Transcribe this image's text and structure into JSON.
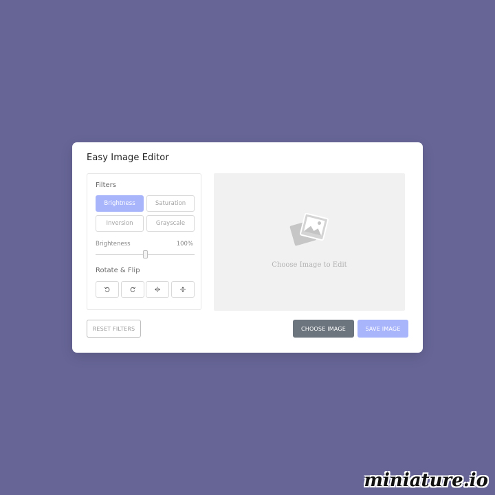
{
  "app": {
    "title": "Easy Image Editor"
  },
  "filters": {
    "label": "Filters",
    "options": [
      "Brightness",
      "Saturation",
      "Inversion",
      "Grayscale"
    ],
    "active": "Brightness"
  },
  "slider": {
    "name": "Brighteness",
    "value_text": "100%",
    "value_fraction": 0.5
  },
  "rotate": {
    "label": "Rotate & Flip",
    "icons": [
      "rotate-left-icon",
      "rotate-right-icon",
      "flip-horizontal-icon",
      "flip-vertical-icon"
    ]
  },
  "preview": {
    "placeholder_text": "Choose Image to Edit",
    "icon": "image-placeholder-icon"
  },
  "actions": {
    "reset_label": "RESET FILTERS",
    "choose_label": "CHOOSE IMAGE",
    "save_label": "SAVE IMAGE"
  },
  "watermark": "miniature.io",
  "colors": {
    "background": "#666596",
    "accent": "#a9b5fb",
    "choose_button": "#6c757d"
  }
}
